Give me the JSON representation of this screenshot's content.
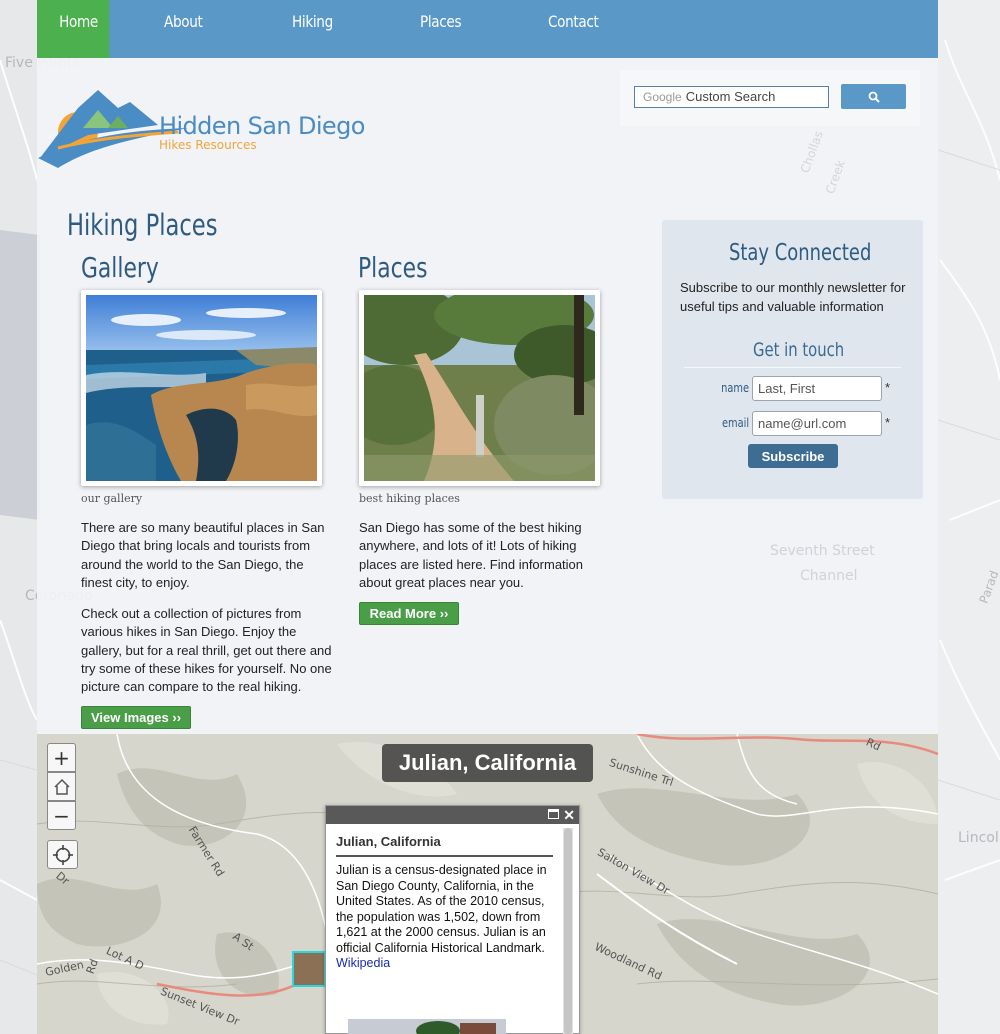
{
  "nav": {
    "items": [
      {
        "label": "Home",
        "active": true
      },
      {
        "label": "About"
      },
      {
        "label": "Hiking"
      },
      {
        "label": "Places"
      },
      {
        "label": "Contact"
      }
    ],
    "color": "#5a98c7",
    "active_color": "#4bb04d"
  },
  "logo": {
    "title": "Hidden San Diego",
    "subtitle": "Hikes Resources"
  },
  "search": {
    "brand": "Google",
    "placeholder": "Custom Search",
    "button_icon": "search-icon"
  },
  "main": {
    "title": "Hiking Places",
    "gallery": {
      "heading": "Gallery",
      "caption": "our gallery",
      "paragraphs": [
        "There are so many beautiful places in San Diego that bring locals and tourists from around the world to the San Diego, the finest city, to enjoy.",
        "Check out a collection of pictures from various hikes in San Diego. Enjoy the gallery, but for a real thrill, get out there and try some of these hikes for yourself. No one picture can compare to the real hiking."
      ],
      "button": "View Images ››"
    },
    "places": {
      "heading": "Places",
      "caption": "best hiking places",
      "paragraph": "San Diego has some of the best hiking anywhere, and lots of it! Lots of hiking places are listed here. Find information about great places near you.",
      "button": "Read More ››"
    }
  },
  "sidebar": {
    "title": "Stay Connected",
    "text": "Subscribe to our monthly newsletter for useful tips and valuable information",
    "form_title": "Get in touch",
    "fields": [
      {
        "label": "name",
        "placeholder": "Last, First",
        "required": "*"
      },
      {
        "label": "email",
        "placeholder": "name@url.com",
        "required": "*"
      }
    ],
    "button": "Subscribe"
  },
  "map": {
    "title": "Julian, California",
    "controls": {
      "zoom_in": "+",
      "zoom_out": "−"
    },
    "popup": {
      "title": "Julian, California",
      "body": "Julian is a census-designated place in San Diego County, California, in the United States. As of the 2010 census, the population was 1,502, down from 1,621 at the 2000 census. Julian is an official California Historical Landmark.",
      "link": "Wikipedia"
    },
    "labels": [
      "Sunshine Trl",
      "Farmer Rd",
      "Salton View Dr",
      "Woodland Rd",
      "Sunset View Dr",
      "Golden",
      "Lot A D",
      "A St",
      "Rd",
      "Rd",
      "Dr"
    ]
  },
  "background_labels": [
    "Five Points",
    "Coronado",
    "Seventh Street",
    "Channel",
    "Lincol",
    "Chollas",
    "Creek",
    "Parad"
  ]
}
